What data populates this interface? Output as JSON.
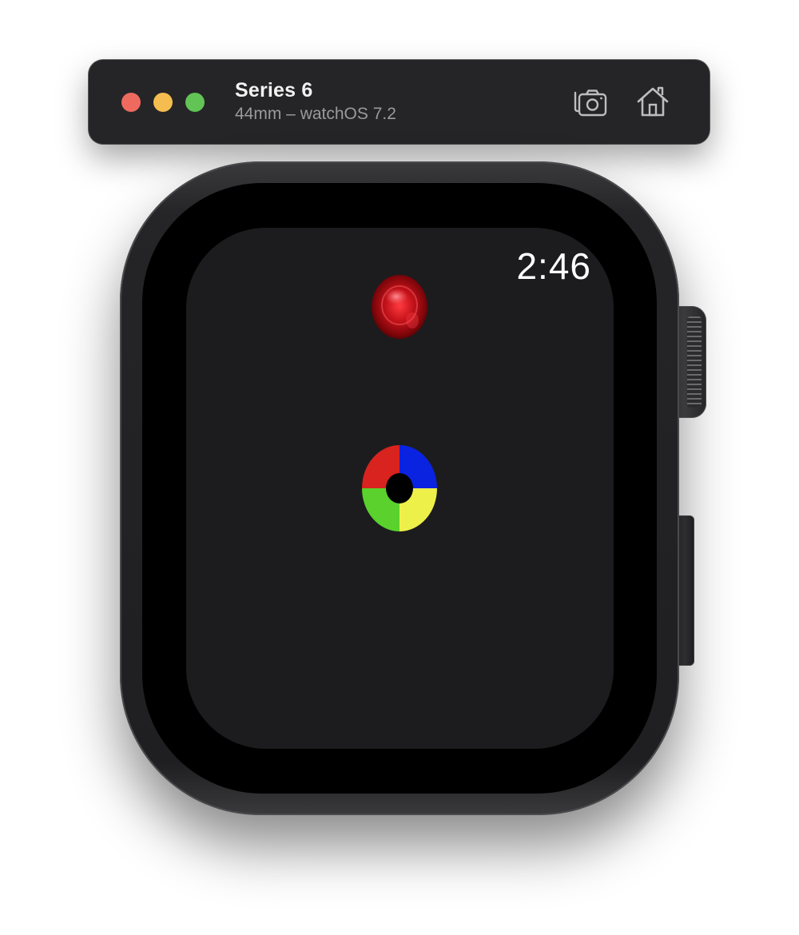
{
  "window": {
    "title": "Series 6",
    "subtitle": "44mm – watchOS 7.2",
    "buttons": {
      "screenshot_icon": "camera-icon",
      "home_icon": "home-icon"
    },
    "traffic_lights": {
      "close": "#ee6a5e",
      "minimize": "#f5bd4f",
      "zoom": "#61c454"
    }
  },
  "watch": {
    "time": "2:46",
    "game": {
      "ball_color": "#d01e24",
      "wheel_colors": {
        "top_left": "#d8231f",
        "top_right": "#0a23e0",
        "bottom_left": "#5ad12c",
        "bottom_right": "#eef04a"
      }
    }
  }
}
